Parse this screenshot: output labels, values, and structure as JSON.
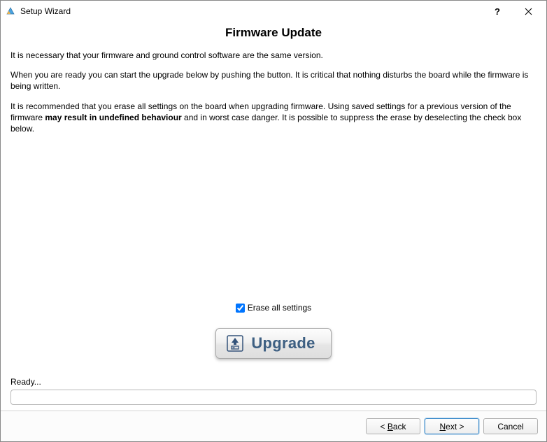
{
  "window": {
    "title": "Setup Wizard"
  },
  "page": {
    "heading": "Firmware Update",
    "para1": "It is necessary that your firmware and ground control software are the same version.",
    "para2": "When you are ready you can start the upgrade below by pushing the button. It is critical that nothing disturbs the board while the firmware is being written.",
    "para3_pre": "It is recommended that you erase all settings on the board when upgrading firmware. Using saved settings for a previous version of the firmware ",
    "para3_bold": "may result in undefined behaviour",
    "para3_post": " and in worst case danger. It is possible to suppress the erase by deselecting the check box below."
  },
  "erase": {
    "label": "Erase all settings",
    "checked": true
  },
  "upgrade": {
    "label": "Upgrade"
  },
  "status": {
    "text": "Ready...",
    "progress": 0
  },
  "footer": {
    "back_prefix": "< ",
    "back_u": "B",
    "back_rest": "ack",
    "next_u": "N",
    "next_rest": "ext >",
    "cancel": "Cancel"
  }
}
